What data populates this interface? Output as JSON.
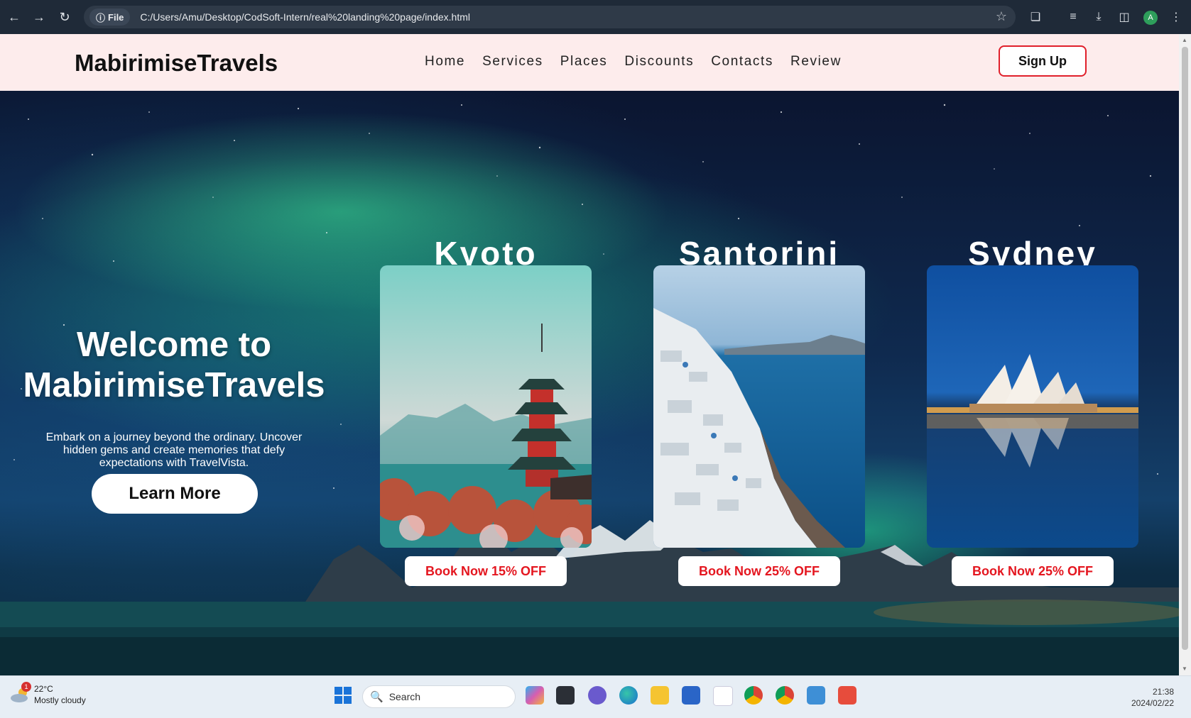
{
  "browser": {
    "file_chip_label": "File",
    "url": "C:/Users/Amu/Desktop/CodSoft-Intern/real%20landing%20page/index.html",
    "profile_initial": "A"
  },
  "site": {
    "logo": "MabirimiseTravels",
    "nav": [
      "Home",
      "Services",
      "Places",
      "Discounts",
      "Contacts",
      "Review"
    ],
    "signup_label": "Sign Up"
  },
  "hero": {
    "title_line1": "Welcome to",
    "title_line2": "MabirimiseTravels",
    "subtitle": "Embark on a journey beyond the ordinary. Uncover hidden gems and create memories that defy expectations with TravelVista.",
    "cta_label": "Learn More"
  },
  "destinations": [
    {
      "name": "Kyoto",
      "button": "Book Now 15% OFF"
    },
    {
      "name": "Santorini",
      "button": "Book Now 25% OFF"
    },
    {
      "name": "Sydney",
      "button": "Book Now 25% OFF"
    }
  ],
  "taskbar": {
    "weather_badge": "1",
    "temperature": "22°C",
    "weather_text": "Mostly cloudy",
    "search_placeholder": "Search",
    "time": "21:38",
    "date": "2024/02/22"
  },
  "colors": {
    "accent_red": "#e4161f",
    "header_bg": "#fdecec",
    "chrome_bg": "#1f2a38"
  }
}
